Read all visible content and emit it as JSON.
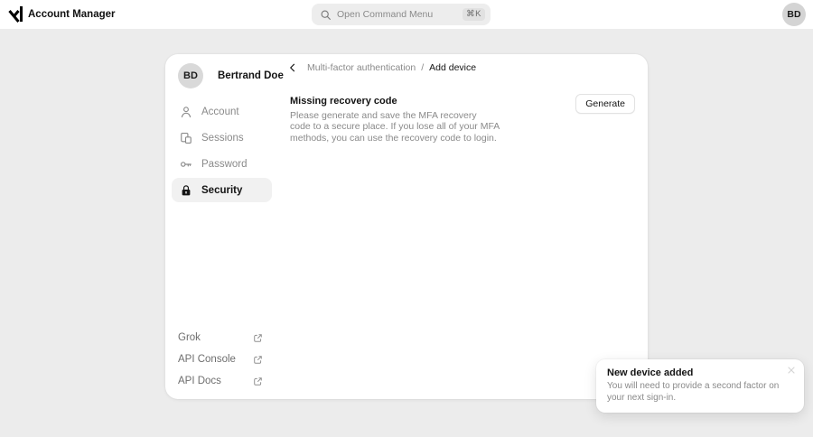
{
  "topbar": {
    "title": "Account Manager",
    "search": {
      "placeholder": "Open Command Menu",
      "shortcut": "⌘K"
    },
    "avatar_initials": "BD"
  },
  "sidebar": {
    "user": {
      "initials": "BD",
      "name": "Bertrand Doe"
    },
    "nav": [
      {
        "label": "Account",
        "icon": "person-icon",
        "active": false
      },
      {
        "label": "Sessions",
        "icon": "devices-icon",
        "active": false
      },
      {
        "label": "Password",
        "icon": "key-icon",
        "active": false
      },
      {
        "label": "Security",
        "icon": "lock-icon",
        "active": true
      }
    ],
    "links": [
      {
        "label": "Grok",
        "icon": "external-link-icon"
      },
      {
        "label": "API Console",
        "icon": "external-link-icon"
      },
      {
        "label": "API Docs",
        "icon": "external-link-icon"
      }
    ]
  },
  "main": {
    "breadcrumb": {
      "parent": "Multi-factor authentication",
      "separator": "/",
      "current": "Add device"
    },
    "section": {
      "title": "Missing recovery code",
      "body": "Please generate and save the MFA recovery code to a secure place. If you lose all of your MFA methods, you can use the recovery code to login.",
      "action_label": "Generate"
    }
  },
  "toast": {
    "title": "New device added",
    "body": "You will need to provide a second factor on your next sign-in."
  },
  "colors": {
    "page_bg": "#ececec",
    "topbar_bg": "#ffffff",
    "card_bg": "#ffffff",
    "active_text": "#141414",
    "muted_text": "#8a8a8a",
    "selected_pill_bg": "#f1f1f1",
    "search_bg": "#ededed",
    "avatar_bg": "#d4d4d4"
  }
}
